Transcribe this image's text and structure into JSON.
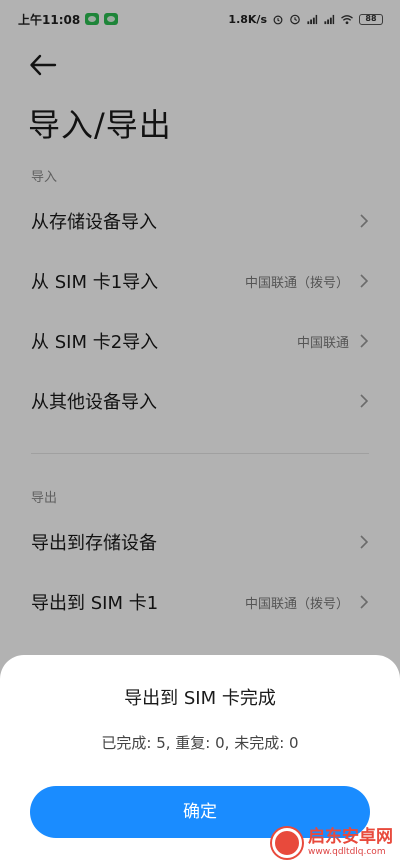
{
  "statusbar": {
    "time": "上午11:08",
    "speed": "1.8K/s",
    "battery": "88"
  },
  "header": {
    "title": "导入/导出"
  },
  "import_section": {
    "label": "导入",
    "items": [
      {
        "label": "从存储设备导入",
        "value": ""
      },
      {
        "label": "从 SIM 卡1导入",
        "value": "中国联通（拨号）"
      },
      {
        "label": "从 SIM 卡2导入",
        "value": "中国联通"
      },
      {
        "label": "从其他设备导入",
        "value": ""
      }
    ]
  },
  "export_section": {
    "label": "导出",
    "items": [
      {
        "label": "导出到存储设备",
        "value": ""
      },
      {
        "label": "导出到 SIM 卡1",
        "value": "中国联通（拨号）"
      }
    ]
  },
  "dialog": {
    "title": "导出到 SIM 卡完成",
    "message": "已完成: 5, 重复: 0, 未完成: 0",
    "confirm_label": "确定"
  },
  "watermark": {
    "name": "启东安卓网",
    "url": "www.qdltdlq.com"
  },
  "colors": {
    "accent": "#1a8cff",
    "overlay": "rgba(0,0,0,0.30)"
  }
}
